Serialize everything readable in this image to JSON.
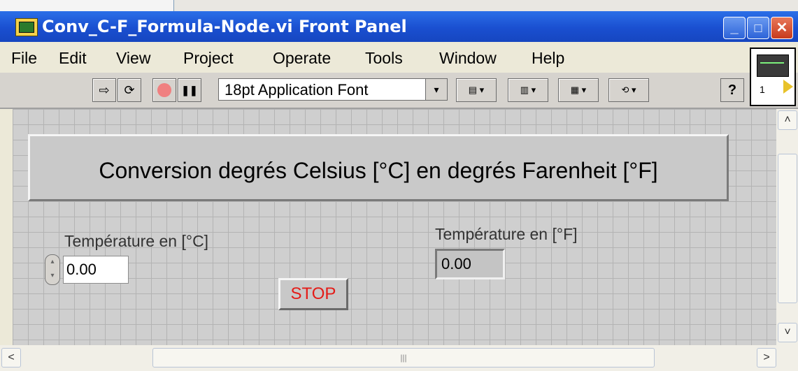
{
  "window": {
    "title": "Conv_C-F_Formula-Node.vi Front Panel"
  },
  "title_buttons": {
    "minimize": "_",
    "maximize": "□",
    "close": "✕"
  },
  "menu": [
    {
      "label": "File"
    },
    {
      "label": "Edit"
    },
    {
      "label": "View"
    },
    {
      "label": "Project"
    },
    {
      "label": "Operate"
    },
    {
      "label": "Tools"
    },
    {
      "label": "Window"
    },
    {
      "label": "Help"
    }
  ],
  "toolbar": {
    "font_select": "18pt Application Font",
    "run_glyph": "⇨",
    "run_continuous_glyph": "⟳",
    "pause_glyph": "❚❚",
    "help_glyph": "?",
    "drop_glyph": "▾"
  },
  "vi_icon": {
    "number": "1"
  },
  "panel": {
    "banner": "Conversion degrés Celsius [°C] en degrés Farenheit [°F]",
    "celsius_label": "Température en [°C]",
    "celsius_value": "0.00",
    "fahrenheit_label": "Température en [°F]",
    "fahrenheit_value": "0.00",
    "stop_label": "STOP"
  },
  "scroll": {
    "up": "˄",
    "down": "˅",
    "left": "<",
    "right": ">",
    "grip": "|||"
  }
}
